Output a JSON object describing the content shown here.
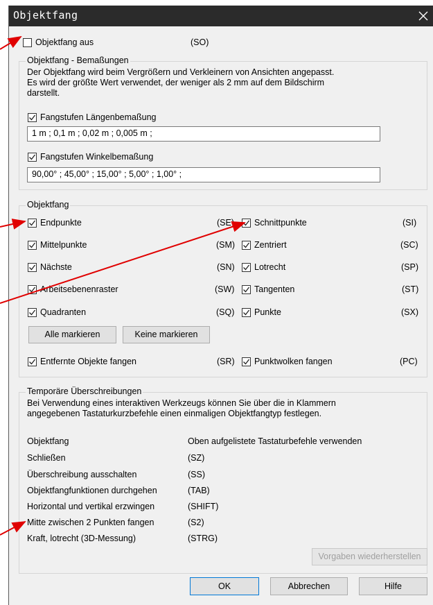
{
  "window": {
    "title": "Objektfang"
  },
  "top": {
    "snap_off_label": "Objektfang aus",
    "snap_off_code": "(SO)"
  },
  "dimensions": {
    "group_title": "Objektfang - Bemaßungen",
    "description": "Der Objektfang wird beim Vergrößern und Verkleinern von Ansichten angepasst.\nEs wird der größte Wert verwendet, der weniger als 2 mm auf dem Bildschirm\ndarstellt.",
    "length_label": "Fangstufen Längenbemaßung",
    "length_value": "1 m ; 0,1 m ; 0,02 m ; 0,005 m ;",
    "angle_label": "Fangstufen Winkelbemaßung",
    "angle_value": "90,00° ; 45,00° ; 15,00° ; 5,00° ; 1,00° ;"
  },
  "snap": {
    "group_title": "Objektfang",
    "left": [
      {
        "label": "Endpunkte",
        "code": "(SE)"
      },
      {
        "label": "Mittelpunkte",
        "code": "(SM)"
      },
      {
        "label": "Nächste",
        "code": "(SN)"
      },
      {
        "label": "Arbeitsebenenraster",
        "code": "(SW)"
      },
      {
        "label": "Quadranten",
        "code": "(SQ)"
      }
    ],
    "right": [
      {
        "label": "Schnittpunkte",
        "code": "(SI)"
      },
      {
        "label": "Zentriert",
        "code": "(SC)"
      },
      {
        "label": "Lotrecht",
        "code": "(SP)"
      },
      {
        "label": "Tangenten",
        "code": "(ST)"
      },
      {
        "label": "Punkte",
        "code": "(SX)"
      }
    ],
    "select_all_label": "Alle markieren",
    "select_none_label": "Keine markieren",
    "remote_label": "Entfernte Objekte fangen",
    "remote_code": "(SR)",
    "cloud_label": "Punktwolken fangen",
    "cloud_code": "(PC)"
  },
  "overrides": {
    "group_title": "Temporäre Überschreibungen",
    "description": "Bei Verwendung eines interaktiven Werkzeugs können Sie über die in Klammern\nangegebenen Tastaturkurzbefehle einen einmaligen Objektfangtyp festlegen.",
    "rows": [
      {
        "name": "Objektfang",
        "value": "Oben aufgelistete Tastaturbefehle verwenden"
      },
      {
        "name": "Schließen",
        "value": "(SZ)"
      },
      {
        "name": "Überschreibung ausschalten",
        "value": "(SS)"
      },
      {
        "name": "Objektfangfunktionen durchgehen",
        "value": "(TAB)"
      },
      {
        "name": "Horizontal und vertikal erzwingen",
        "value": "(SHIFT)"
      },
      {
        "name": "Mitte zwischen 2 Punkten fangen",
        "value": "(S2)"
      },
      {
        "name": "Kraft, lotrecht (3D-Messung)",
        "value": "(STRG)"
      }
    ]
  },
  "buttons": {
    "restore_label": "Vorgaben wiederherstellen",
    "ok_label": "OK",
    "cancel_label": "Abbrechen",
    "help_label": "Hilfe"
  },
  "colors": {
    "titlebar": "#2b2b2b",
    "dialog": "#f0f0f0",
    "annotation": "#e00000",
    "primary_border": "#0078d7"
  }
}
